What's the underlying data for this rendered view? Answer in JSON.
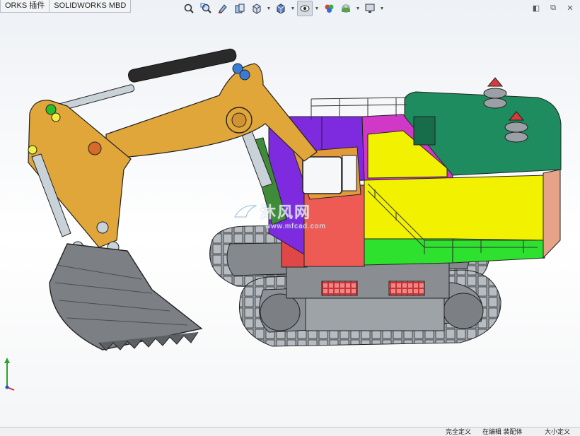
{
  "tabs": [
    {
      "label": "ORKS 插件"
    },
    {
      "label": "SOLIDWORKS MBD"
    }
  ],
  "toolbar": {
    "icons": [
      "zoom-to-fit-icon",
      "zoom-area-icon",
      "previous-view-icon",
      "section-view-icon",
      "view-orientation-icon",
      "display-style-icon",
      "hide-show-items-icon",
      "edit-appearance-icon",
      "apply-scene-icon",
      "view-settings-icon"
    ]
  },
  "watermark": {
    "text": "沐风网",
    "url": "www.mfcad.com"
  },
  "status": {
    "left_text": "在编辑 装配体",
    "mid_text": "大小定义",
    "right_text": "完全定义"
  },
  "colors": {
    "boom": "#E0A63A",
    "counterweight_top": "#1E8C5E",
    "engine_yellow": "#F2F200",
    "panel_magenta": "#D238C8",
    "panel_purple": "#7E2BE0",
    "cab_red": "#EE5B55",
    "panel_green": "#2EE12E",
    "panel_salmon": "#E7A388",
    "track": "#8F959C",
    "bucket": "#7C7F84"
  }
}
